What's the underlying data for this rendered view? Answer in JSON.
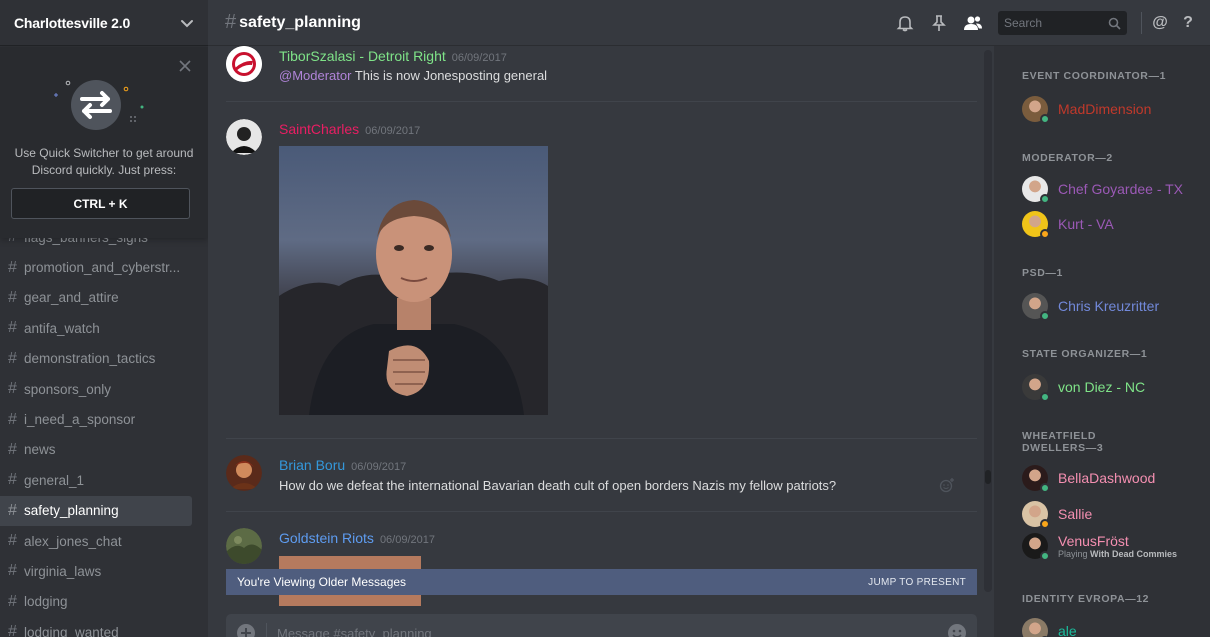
{
  "server": {
    "name": "Charlottesville 2.0"
  },
  "quick_switcher": {
    "text": "Use Quick Switcher to get around Discord quickly. Just press:",
    "shortcut": "CTRL + K"
  },
  "channels": [
    {
      "name": "flags_banners_signs"
    },
    {
      "name": "promotion_and_cyberstr..."
    },
    {
      "name": "gear_and_attire"
    },
    {
      "name": "antifa_watch"
    },
    {
      "name": "demonstration_tactics"
    },
    {
      "name": "sponsors_only"
    },
    {
      "name": "i_need_a_sponsor"
    },
    {
      "name": "news"
    },
    {
      "name": "general_1"
    },
    {
      "name": "safety_planning",
      "active": true
    },
    {
      "name": "alex_jones_chat"
    },
    {
      "name": "virginia_laws"
    },
    {
      "name": "lodging"
    },
    {
      "name": "lodging_wanted"
    }
  ],
  "header": {
    "channel": "safety_planning",
    "search_placeholder": "Search",
    "mention_icon": "@",
    "help_icon": "?"
  },
  "messages": [
    {
      "author": "TiborSzalasi - Detroit Right",
      "author_color": "#7fe388",
      "timestamp": "06/09/2017",
      "mention": "@Moderator",
      "text": "This is now Jonesposting general"
    },
    {
      "author": "SaintCharles",
      "author_color": "#e91e63",
      "timestamp": "06/09/2017",
      "text": ""
    },
    {
      "author": "Brian Boru",
      "author_color": "#3498db",
      "timestamp": "06/09/2017",
      "text": "How do we defeat the international Bavarian death cult of open borders Nazis my fellow patriots?"
    },
    {
      "author": "Goldstein Riots",
      "author_color": "#5e9cf0",
      "timestamp": "06/09/2017",
      "text": ""
    }
  ],
  "older_bar": {
    "text": "You're Viewing Older Messages",
    "action": "JUMP TO PRESENT"
  },
  "composer": {
    "placeholder": "Message #safety_planning"
  },
  "member_groups": [
    {
      "title": "EVENT COORDINATOR—1",
      "members": [
        {
          "name": "MadDimension",
          "color": "#c0392b",
          "status": "#43b581"
        }
      ]
    },
    {
      "title": "MODERATOR—2",
      "members": [
        {
          "name": "Chef Goyardee - TX",
          "color": "#9b59b6",
          "status": "#43b581"
        },
        {
          "name": "Kurt - VA",
          "color": "#9b59b6",
          "status": "#faa61a"
        }
      ]
    },
    {
      "title": "PSD—1",
      "members": [
        {
          "name": "Chris Kreuzritter",
          "color": "#7289da",
          "status": "#43b581"
        }
      ]
    },
    {
      "title": "STATE ORGANIZER—1",
      "members": [
        {
          "name": "von Diez - NC",
          "color": "#7fe388",
          "status": "#43b581"
        }
      ]
    },
    {
      "title": "WHEATFIELD DWELLERS—3",
      "members": [
        {
          "name": "BellaDashwood",
          "color": "#f48fb1",
          "status": "#43b581"
        },
        {
          "name": "Sallie",
          "color": "#f48fb1",
          "status": "#faa61a"
        },
        {
          "name": "VenusFröst",
          "color": "#f48fb1",
          "status": "#43b581",
          "playing_prefix": "Playing",
          "playing_game": "With Dead Commies"
        }
      ]
    },
    {
      "title": "IDENTITY EVROPA—12",
      "members": [
        {
          "name": "ale",
          "color": "#1abc9c",
          "status": "#43b581"
        }
      ]
    }
  ]
}
